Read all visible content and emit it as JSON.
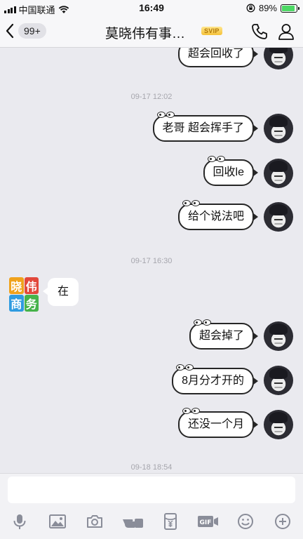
{
  "status_bar": {
    "carrier": "中国联通",
    "time": "16:49",
    "battery_percent": "89%",
    "battery_level": 0.89
  },
  "nav": {
    "back_badge": "99+",
    "title": "莫晓伟有事…",
    "vip_badge": "SVIP"
  },
  "messages": [
    {
      "side": "me",
      "text": "超会回收了"
    },
    {
      "type": "timestamp",
      "text": "09-17 12:02"
    },
    {
      "side": "me",
      "text": "老哥 超会挥手了"
    },
    {
      "side": "me",
      "text": "回收le"
    },
    {
      "side": "me",
      "text": "给个说法吧"
    },
    {
      "type": "timestamp",
      "text": "09-17 16:30"
    },
    {
      "side": "them",
      "text": "在"
    },
    {
      "side": "me",
      "text": "超会掉了"
    },
    {
      "side": "me",
      "text": "8月分才开的"
    },
    {
      "side": "me",
      "text": "还没一个月"
    },
    {
      "type": "timestamp",
      "text": "09-18 18:54"
    }
  ],
  "contact_avatar": {
    "chars": [
      "晓",
      "伟",
      "商",
      "务"
    ],
    "colors": [
      "#f0a21c",
      "#e2483b",
      "#2f9be0",
      "#46b34a"
    ]
  },
  "input": {
    "placeholder": ""
  },
  "toolbar": {
    "items": [
      "mic-icon",
      "image-icon",
      "camera-icon",
      "poke-icon",
      "red-packet-icon",
      "gif-icon",
      "emoji-icon",
      "plus-icon"
    ]
  },
  "colors": {
    "accent": "#4cd964",
    "icon": "#8a8d99"
  }
}
